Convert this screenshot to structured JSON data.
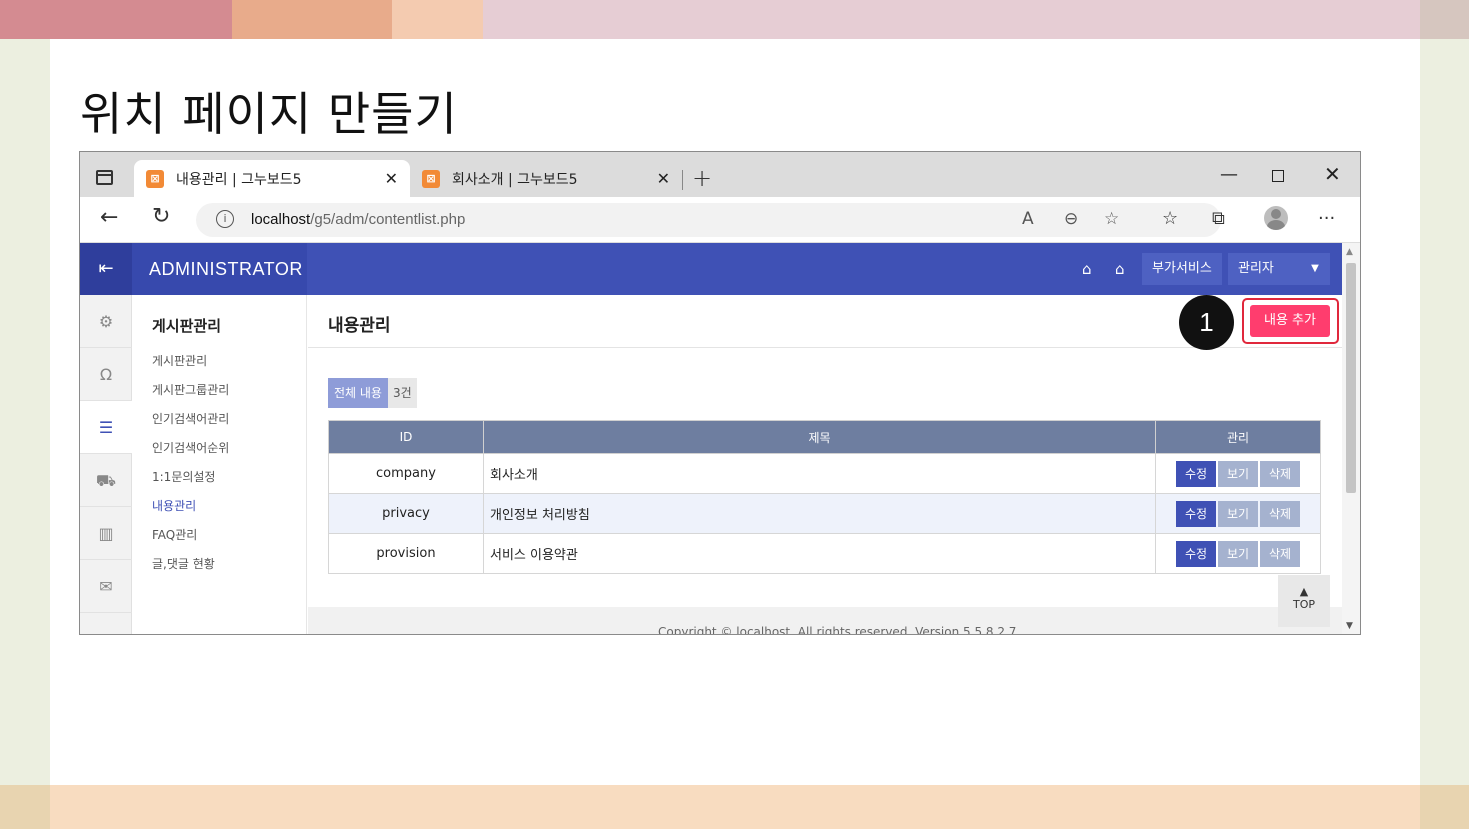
{
  "slide": {
    "title": "위치 페이지 만들기"
  },
  "browser": {
    "tabs": [
      {
        "title": "내용관리 | 그누보드5",
        "favicon": "xampp-icon"
      },
      {
        "title": "회사소개 | 그누보드5",
        "favicon": "xampp-icon"
      }
    ],
    "url_host": "localhost",
    "url_path": "/g5/adm/contentlist.php"
  },
  "admin": {
    "logo": "ADMINISTRATOR",
    "addon_label": "부가서비스",
    "admin_label": "관리자",
    "menu_title": "게시판관리",
    "menu_items": [
      {
        "label": "게시판관리"
      },
      {
        "label": "게시판그룹관리"
      },
      {
        "label": "인기검색어관리"
      },
      {
        "label": "인기검색어순위"
      },
      {
        "label": "1:1문의설정"
      },
      {
        "label": "내용관리"
      },
      {
        "label": "FAQ관리"
      },
      {
        "label": "글,댓글 현황"
      }
    ],
    "active_menu": "내용관리"
  },
  "content": {
    "heading": "내용관리",
    "step_badge": "1",
    "add_button": "내용 추가",
    "count_label": "전체 내용",
    "count_value": "3건",
    "columns": {
      "id": "ID",
      "subject": "제목",
      "manage": "관리"
    },
    "rows": [
      {
        "id": "company",
        "subject": "회사소개"
      },
      {
        "id": "privacy",
        "subject": "개인정보 처리방침"
      },
      {
        "id": "provision",
        "subject": "서비스 이용약관"
      }
    ],
    "actions": {
      "edit": "수정",
      "view": "보기",
      "delete": "삭제"
    },
    "top_label": "TOP",
    "copyright": "Copyright © localhost. All rights reserved. Version 5.5.8.2.7"
  },
  "colors": {
    "admin_header": "#3f51b5",
    "add_button": "#ff3d6e",
    "highlight_frame": "#e0283c"
  }
}
